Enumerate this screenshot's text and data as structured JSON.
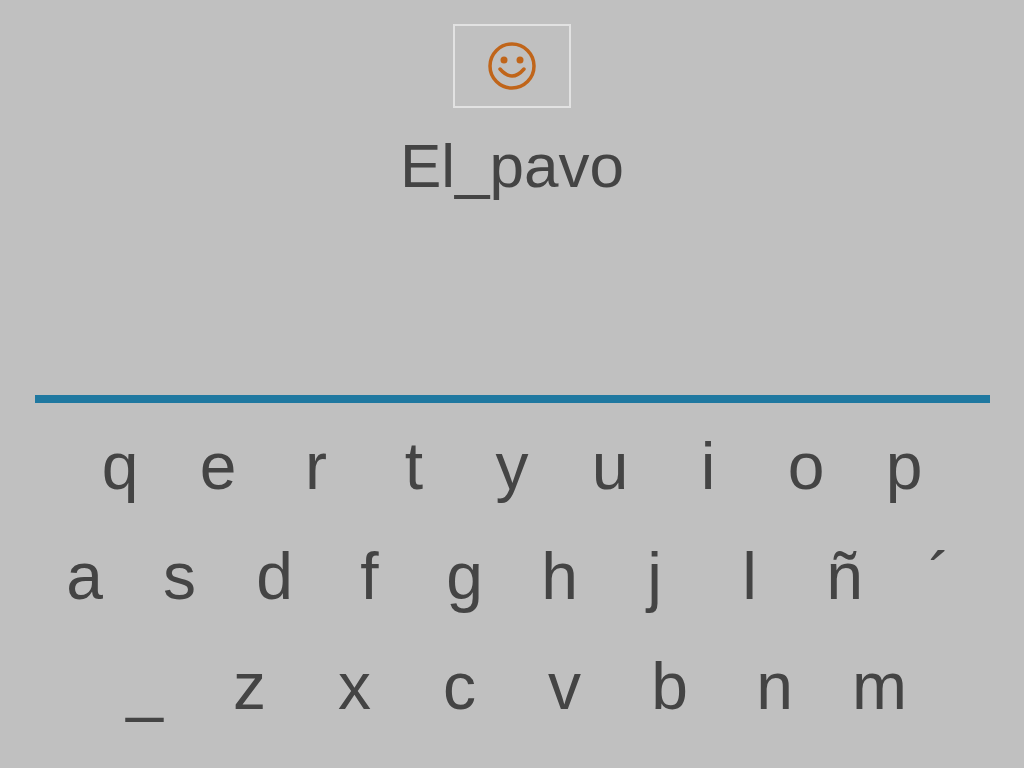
{
  "word": "El_pavo",
  "keyboard": {
    "rows": [
      [
        "q",
        "e",
        "r",
        "t",
        "y",
        "u",
        "i",
        "o",
        "p"
      ],
      [
        "a",
        "s",
        "d",
        "f",
        "g",
        "h",
        "j",
        "l",
        "ñ",
        "´"
      ],
      [
        "_",
        "z",
        "x",
        "c",
        "v",
        "b",
        "n",
        "m"
      ]
    ]
  }
}
